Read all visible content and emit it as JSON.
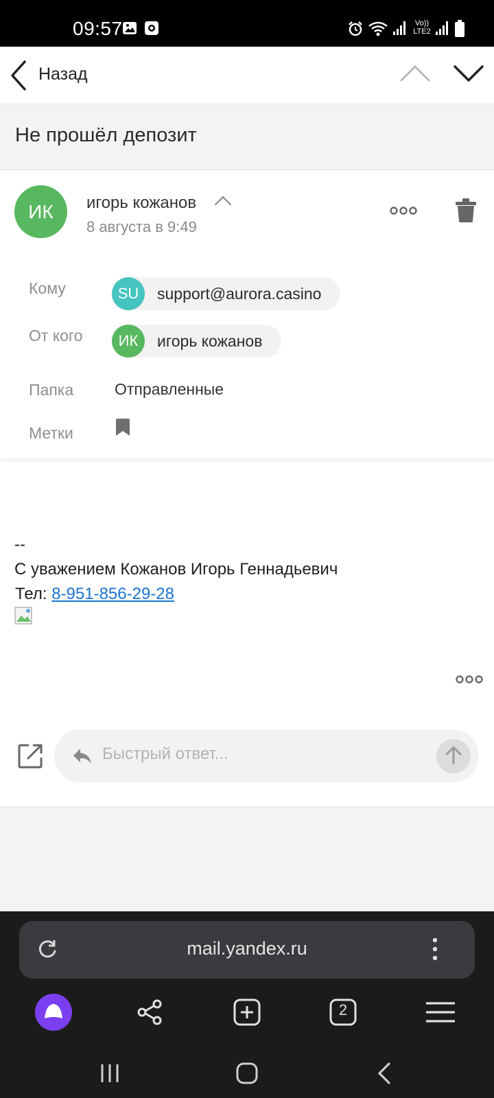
{
  "status_bar": {
    "time": "09:57",
    "lte_label": "VoLTE2"
  },
  "nav": {
    "back_label": "Назад"
  },
  "subject": "Не прошёл депозит",
  "sender": {
    "initials": "ИК",
    "name": "игорь кожанов",
    "date": "8 августа в 9:49"
  },
  "fields": {
    "to_label": "Кому",
    "from_label": "От кого",
    "folder_label": "Папка",
    "tags_label": "Метки",
    "to_chip": {
      "initials": "SU",
      "email": "support@aurora.casino",
      "color": "#45c4c0"
    },
    "from_chip": {
      "initials": "ИК",
      "name": "игорь кожанов",
      "color": "#58b85f"
    },
    "folder_value": "Отправленные"
  },
  "body": {
    "dashes": "--",
    "signature": "С уважением Кожанов Игорь Геннадьевич",
    "phone_prefix": "Тел: ",
    "phone": "8-951-856-29-28"
  },
  "reply": {
    "placeholder": "Быстрый ответ..."
  },
  "browser": {
    "url": "mail.yandex.ru",
    "tabs_count": "2"
  },
  "colors": {
    "accent_green": "#58b85f",
    "link_blue": "#1a73d1",
    "alice_purple": "#7b3ff2"
  },
  "icons": [
    "image-icon",
    "screen-record-icon",
    "alarm-icon",
    "wifi-icon",
    "signal-icon",
    "battery-icon",
    "back-arrow-icon",
    "chevron-up-icon",
    "chevron-down-icon",
    "more-icon",
    "trash-icon",
    "bookmark-icon",
    "compose-icon",
    "reply-icon",
    "send-arrow-icon",
    "reload-icon",
    "kebab-icon",
    "alice-icon",
    "share-icon",
    "new-tab-icon",
    "tabs-icon",
    "menu-icon",
    "recent-apps-icon",
    "home-icon",
    "system-back-icon"
  ]
}
